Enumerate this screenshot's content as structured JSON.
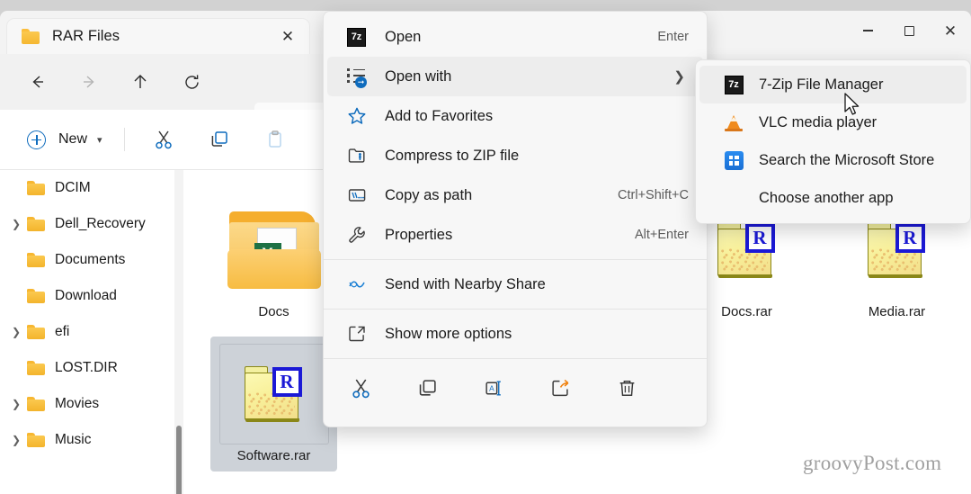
{
  "window": {
    "tab_title": "RAR Files",
    "tab_close_icon": "close-icon",
    "controls": {
      "minimize": "minimize-icon",
      "maximize": "maximize-icon",
      "close": "close-icon"
    }
  },
  "navbar": {
    "back_icon": "back-arrow-icon",
    "forward_icon": "forward-arrow-icon",
    "up_icon": "up-arrow-icon",
    "refresh_icon": "refresh-icon",
    "breadcrumb_icon": "this-pc-monitor-icon",
    "breadcrumb_chevron": "chevron-right-icon"
  },
  "commandbar": {
    "new_label": "New",
    "new_icon": "plus-circle-icon",
    "new_chevron": "chevron-down-icon",
    "cut_icon": "scissors-icon",
    "copy_icon": "copy-icon",
    "paste_icon": "paste-icon"
  },
  "sidebar": {
    "items": [
      {
        "label": "DCIM",
        "expandable": false
      },
      {
        "label": "Dell_Recovery",
        "expandable": true
      },
      {
        "label": "Documents",
        "expandable": false
      },
      {
        "label": "Download",
        "expandable": false
      },
      {
        "label": "efi",
        "expandable": true
      },
      {
        "label": "LOST.DIR",
        "expandable": false
      },
      {
        "label": "Movies",
        "expandable": true
      },
      {
        "label": "Music",
        "expandable": true
      }
    ]
  },
  "files": [
    {
      "name": "Docs",
      "type": "folder-excel",
      "selected": false
    },
    {
      "name": "Software.rar",
      "type": "rar",
      "selected": true
    },
    {
      "name": "Docs.rar",
      "type": "rar",
      "selected": false
    },
    {
      "name": "Media.rar",
      "type": "rar",
      "selected": false
    }
  ],
  "context_menu": {
    "items": [
      {
        "label": "Open",
        "accel": "Enter",
        "icon": "sevenzip-icon",
        "submenu": false,
        "highlighted": false
      },
      {
        "label": "Open with",
        "accel": "",
        "icon": "open-with-icon",
        "submenu": true,
        "highlighted": true
      },
      {
        "label": "Add to Favorites",
        "accel": "",
        "icon": "star-icon",
        "submenu": false,
        "highlighted": false
      },
      {
        "label": "Compress to ZIP file",
        "accel": "",
        "icon": "zip-folder-icon",
        "submenu": false,
        "highlighted": false
      },
      {
        "label": "Copy as path",
        "accel": "Ctrl+Shift+C",
        "icon": "copy-path-icon",
        "submenu": false,
        "highlighted": false
      },
      {
        "label": "Properties",
        "accel": "Alt+Enter",
        "icon": "wrench-icon",
        "submenu": false,
        "highlighted": false
      },
      {
        "label": "Send with Nearby Share",
        "accel": "",
        "icon": "nearby-share-icon",
        "submenu": false,
        "highlighted": false
      },
      {
        "label": "Show more options",
        "accel": "",
        "icon": "show-more-options-icon",
        "submenu": false,
        "highlighted": false
      }
    ],
    "action_icons": [
      "cut-icon",
      "copy-icon",
      "rename-icon",
      "share-icon",
      "delete-icon"
    ]
  },
  "submenu": {
    "items": [
      {
        "label": "7-Zip File Manager",
        "icon": "sevenzip-icon",
        "highlighted": true
      },
      {
        "label": "VLC media player",
        "icon": "vlc-icon",
        "highlighted": false
      },
      {
        "label": "Search the Microsoft Store",
        "icon": "microsoft-store-icon",
        "highlighted": false
      },
      {
        "label": "Choose another app",
        "icon": "",
        "highlighted": false
      }
    ]
  },
  "watermark": "groovyPost.com",
  "colors": {
    "accent": "#0f6cbd",
    "window_bg": "#f3f3f3",
    "menu_bg": "#f7f7f7",
    "selection": "#cdd2d8"
  }
}
